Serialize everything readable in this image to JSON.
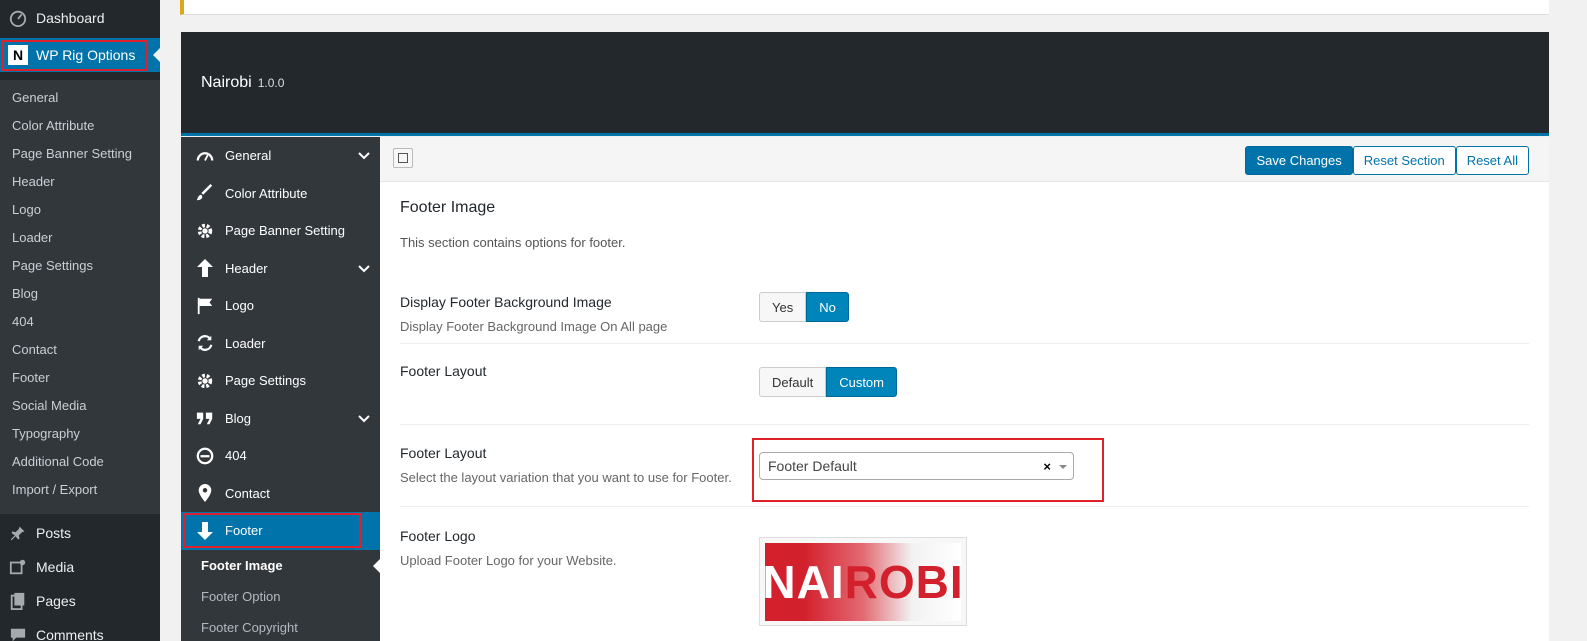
{
  "wp_menu": {
    "dashboard": "Dashboard",
    "current": "WP Rig Options",
    "submenu": [
      "General",
      "Color Attribute",
      "Page Banner Setting",
      "Header",
      "Logo",
      "Loader",
      "Page Settings",
      "Blog",
      "404",
      "Contact",
      "Footer",
      "Social Media",
      "Typography",
      "Additional Code",
      "Import / Export"
    ],
    "bottom": [
      "Posts",
      "Media",
      "Pages",
      "Comments"
    ]
  },
  "header": {
    "title": "Nairobi",
    "version": "1.0.0"
  },
  "panel_nav": {
    "items": [
      "General",
      "Color Attribute",
      "Page Banner Setting",
      "Header",
      "Logo",
      "Loader",
      "Page Settings",
      "Blog",
      "404",
      "Contact",
      "Footer"
    ],
    "footer_sub": [
      "Footer Image",
      "Footer Option",
      "Footer Copyright"
    ]
  },
  "toolbar": {
    "save": "Save Changes",
    "reset_section": "Reset Section",
    "reset_all": "Reset All"
  },
  "section": {
    "title": "Footer Image",
    "description": "This section contains options for footer.",
    "display_bg": {
      "label": "Display Footer Background Image",
      "sub": "Display Footer Background Image On All page",
      "options": [
        "Yes",
        "No"
      ],
      "selected": "No"
    },
    "layout1": {
      "label": "Footer Layout",
      "options": [
        "Default",
        "Custom"
      ],
      "selected": "Custom"
    },
    "layout2": {
      "label": "Footer Layout",
      "sub": "Select the layout variation that you want to use for Footer.",
      "value": "Footer Default",
      "clear": "×"
    },
    "logo": {
      "label": "Footer Logo",
      "sub": "Upload Footer Logo for your Website.",
      "logo_text_a": "NAI",
      "logo_text_b": "ROBI"
    }
  },
  "colors": {
    "accent": "#0073aa",
    "admin_bg": "#23282d",
    "highlight": "#e0202a"
  }
}
